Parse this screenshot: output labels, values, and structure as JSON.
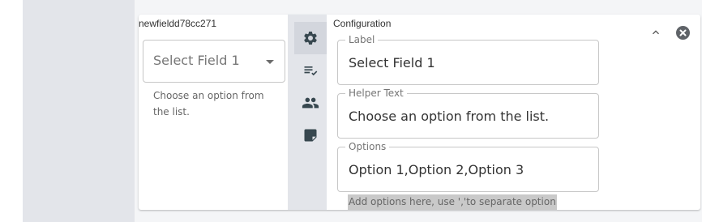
{
  "field": {
    "name": "newfieldd78cc271",
    "select_value": "Select Field 1",
    "helper_text": "Choose an option from the list."
  },
  "toolbar": {
    "items": [
      {
        "icon": "gear-icon",
        "active": true
      },
      {
        "icon": "checklist-icon",
        "active": false
      },
      {
        "icon": "people-icon",
        "active": false
      },
      {
        "icon": "note-icon",
        "active": false
      }
    ]
  },
  "config": {
    "title": "Configuration",
    "label_legend": "Label",
    "label_value": "Select Field 1",
    "helper_legend": "Helper Text",
    "helper_value": "Choose an option from the list.",
    "options_legend": "Options",
    "options_value": "Option 1,Option 2,Option 3",
    "options_hint": "Add options here, use ','to separate option"
  },
  "colors": {
    "panel_gray": "#e3e5ea",
    "active_tool": "#d3d6dd",
    "icon": "#37474f",
    "close_button": "#5f6368"
  }
}
